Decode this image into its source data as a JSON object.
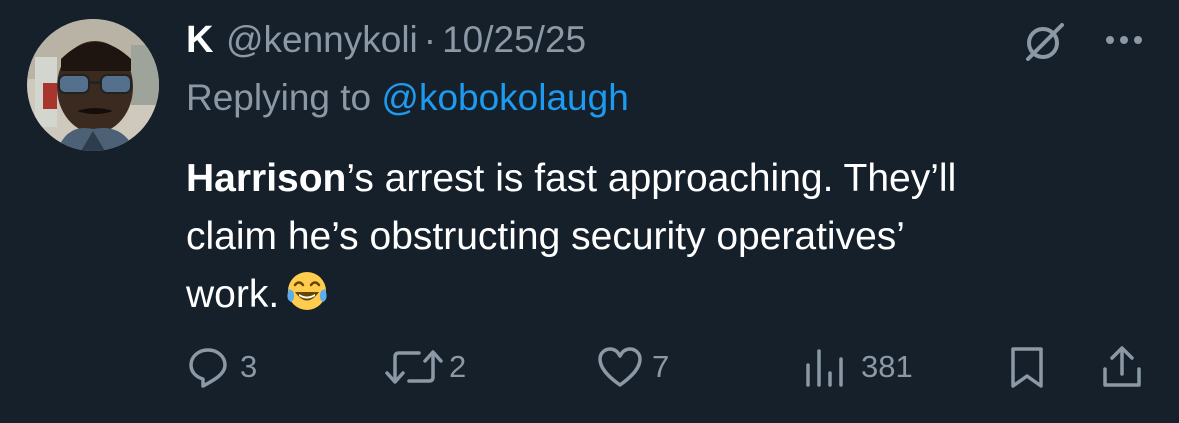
{
  "author": {
    "display_name": "K",
    "handle": "@kennykoli",
    "separator": "·",
    "date": "10/25/25"
  },
  "reply": {
    "prefix": "Replying to ",
    "mention": "@kobokolaugh"
  },
  "tweet": {
    "bold_name": "Harrison",
    "line1_rest": "’s arrest is fast approaching. They’ll",
    "line2": "claim he’s obstructing security operatives’",
    "line3": "work.",
    "emoji": "face-with-tears-of-joy"
  },
  "actions": {
    "replies": "3",
    "reposts": "2",
    "likes": "7",
    "views": "381"
  },
  "icons": {
    "header": [
      "grok-icon",
      "more-icon"
    ],
    "actions": [
      "reply-icon",
      "repost-icon",
      "like-icon",
      "views-icon",
      "bookmark-icon",
      "share-icon"
    ]
  },
  "colors": {
    "background": "#15202b",
    "text": "#ffffff",
    "secondary": "#8b98a5",
    "link": "#1d9bf0"
  }
}
